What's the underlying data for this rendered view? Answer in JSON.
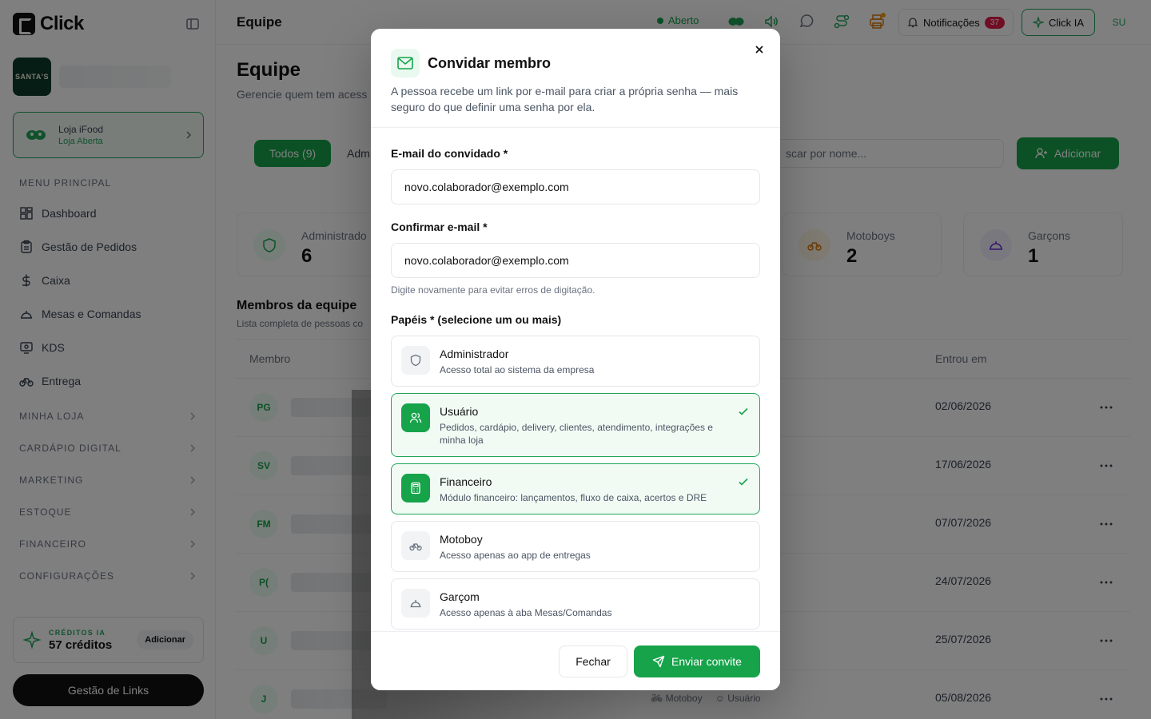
{
  "app": {
    "name": "Click"
  },
  "sidebar": {
    "store_logo_text": "SANTA'S",
    "ifood": {
      "title": "Loja iFood",
      "status": "Loja Aberta"
    },
    "menu_header": "MENU PRINCIPAL",
    "items": [
      {
        "label": "Dashboard",
        "icon": "dashboard-icon"
      },
      {
        "label": "Gestão de Pedidos",
        "icon": "clipboard-icon"
      },
      {
        "label": "Caixa",
        "icon": "dollar-icon"
      },
      {
        "label": "Mesas e Comandas",
        "icon": "cloche-icon"
      },
      {
        "label": "KDS",
        "icon": "monitor-icon"
      },
      {
        "label": "Entrega",
        "icon": "bike-icon"
      }
    ],
    "sections": [
      "MINHA LOJA",
      "CARDÁPIO DIGITAL",
      "MARKETING",
      "ESTOQUE",
      "FINANCEIRO",
      "CONFIGURAÇÕES"
    ],
    "credits": {
      "label": "CRÉDITOS IA",
      "value": "57 créditos",
      "add_label": "Adicionar"
    },
    "links_button": "Gestão de Links"
  },
  "header": {
    "title": "Equipe",
    "status": "Aberto",
    "notifications_label": "Notificações",
    "notifications_count": "37",
    "ia_label": "Click IA",
    "avatar": "SU"
  },
  "main": {
    "title": "Equipe",
    "subtitle": "Gerencie quem tem acess",
    "tabs": [
      {
        "label": "Todos (9)"
      },
      {
        "label": "Adm"
      }
    ],
    "search_placeholder": "scar por nome...",
    "add_button": "Adicionar",
    "stats": [
      {
        "label": "Administrado",
        "value": "6",
        "icon": "shield-icon"
      },
      {
        "label": "Motoboys",
        "value": "2",
        "icon": "bike-icon"
      },
      {
        "label": "Garçons",
        "value": "1",
        "icon": "cloche-icon"
      }
    ],
    "members_title": "Membros da equipe",
    "members_sub": "Lista completa de pessoas co",
    "columns": {
      "member": "Membro",
      "joined": "Entrou em"
    },
    "rows": [
      {
        "initials": "PG",
        "date": "02/06/2026"
      },
      {
        "initials": "SV",
        "date": "17/06/2026"
      },
      {
        "initials": "FM",
        "date": "07/07/2026"
      },
      {
        "initials": "P(",
        "date": "24/07/2026"
      },
      {
        "initials": "U",
        "date": "25/07/2026"
      },
      {
        "initials": "J",
        "date": "05/08/2026",
        "tags": [
          "Motoboy",
          "Usuário"
        ]
      }
    ]
  },
  "modal": {
    "title": "Convidar membro",
    "description": "A pessoa recebe um link por e-mail para criar a própria senha — mais seguro do que definir uma senha por ela.",
    "email_label": "E-mail do convidado *",
    "email_value": "novo.colaborador@exemplo.com",
    "confirm_label": "Confirmar e-mail *",
    "confirm_value": "novo.colaborador@exemplo.com",
    "confirm_hint": "Digite novamente para evitar erros de digitação.",
    "roles_label": "Papéis * (selecione um ou mais)",
    "roles": [
      {
        "name": "Administrador",
        "desc": "Acesso total ao sistema da empresa",
        "selected": false,
        "icon": "shield-icon"
      },
      {
        "name": "Usuário",
        "desc": "Pedidos, cardápio, delivery, clientes, atendimento, integrações e minha loja",
        "selected": true,
        "icon": "users-icon"
      },
      {
        "name": "Financeiro",
        "desc": "Módulo financeiro: lançamentos, fluxo de caixa, acertos e DRE",
        "selected": true,
        "icon": "calculator-icon"
      },
      {
        "name": "Motoboy",
        "desc": "Acesso apenas ao app de entregas",
        "selected": false,
        "icon": "bike-icon"
      },
      {
        "name": "Garçom",
        "desc": "Acesso apenas à aba Mesas/Comandas",
        "selected": false,
        "icon": "cloche-icon"
      }
    ],
    "cancel_label": "Fechar",
    "submit_label": "Enviar convite"
  },
  "colors": {
    "accent": "#16a34a",
    "accent_light": "#f1fbf4",
    "danger": "#e11d48"
  }
}
